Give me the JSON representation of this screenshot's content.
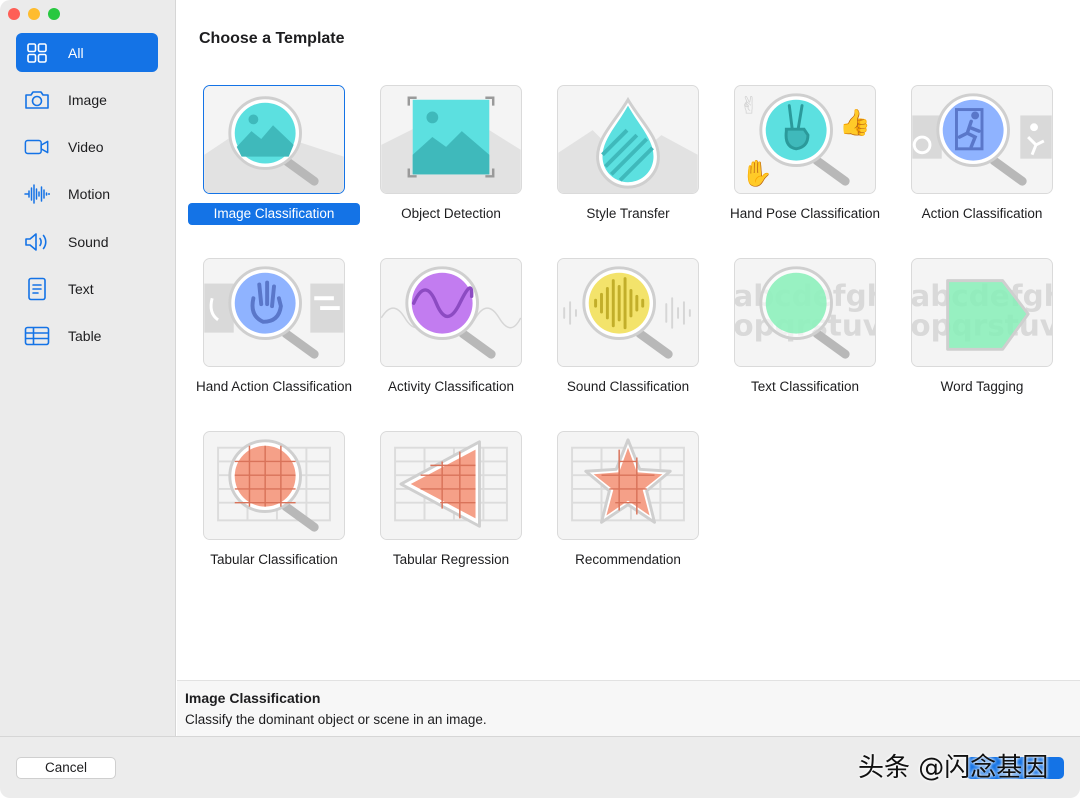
{
  "window": {
    "title": "Choose a Template"
  },
  "sidebar": {
    "items": [
      {
        "label": "All",
        "icon": "grid-icon",
        "active": true
      },
      {
        "label": "Image",
        "icon": "camera-icon",
        "active": false
      },
      {
        "label": "Video",
        "icon": "video-camera-icon",
        "active": false
      },
      {
        "label": "Motion",
        "icon": "waveform-icon",
        "active": false
      },
      {
        "label": "Sound",
        "icon": "speaker-icon",
        "active": false
      },
      {
        "label": "Text",
        "icon": "document-icon",
        "active": false
      },
      {
        "label": "Table",
        "icon": "table-icon",
        "active": false
      }
    ]
  },
  "templates": [
    {
      "label": "Image Classification",
      "selected": true,
      "icon": "image-classification-icon"
    },
    {
      "label": "Object Detection",
      "selected": false,
      "icon": "object-detection-icon"
    },
    {
      "label": "Style Transfer",
      "selected": false,
      "icon": "style-transfer-icon"
    },
    {
      "label": "Hand Pose Classification",
      "selected": false,
      "icon": "hand-pose-icon"
    },
    {
      "label": "Action Classification",
      "selected": false,
      "icon": "action-classification-icon"
    },
    {
      "label": "Hand Action Classification",
      "selected": false,
      "icon": "hand-action-icon"
    },
    {
      "label": "Activity Classification",
      "selected": false,
      "icon": "activity-classification-icon"
    },
    {
      "label": "Sound Classification",
      "selected": false,
      "icon": "sound-classification-icon"
    },
    {
      "label": "Text Classification",
      "selected": false,
      "icon": "text-classification-icon"
    },
    {
      "label": "Word Tagging",
      "selected": false,
      "icon": "word-tagging-icon"
    },
    {
      "label": "Tabular Classification",
      "selected": false,
      "icon": "tabular-classification-icon"
    },
    {
      "label": "Tabular Regression",
      "selected": false,
      "icon": "tabular-regression-icon"
    },
    {
      "label": "Recommendation",
      "selected": false,
      "icon": "recommendation-icon"
    }
  ],
  "thumb_text": {
    "row1": "abcdefghi",
    "row2": "opqrstuvw"
  },
  "description": {
    "title": "Image Classification",
    "text": "Classify the dominant object or scene in an image."
  },
  "footer": {
    "cancel_label": "Cancel",
    "watermark": "头条 @闪念基因"
  },
  "colors": {
    "accent": "#1473e6",
    "cyan": "#5ce0e0",
    "violet": "#c27cf0",
    "yellow": "#f3e36b",
    "mint": "#86efb7",
    "salmon": "#f5a088",
    "blue": "#8fb3ff"
  }
}
